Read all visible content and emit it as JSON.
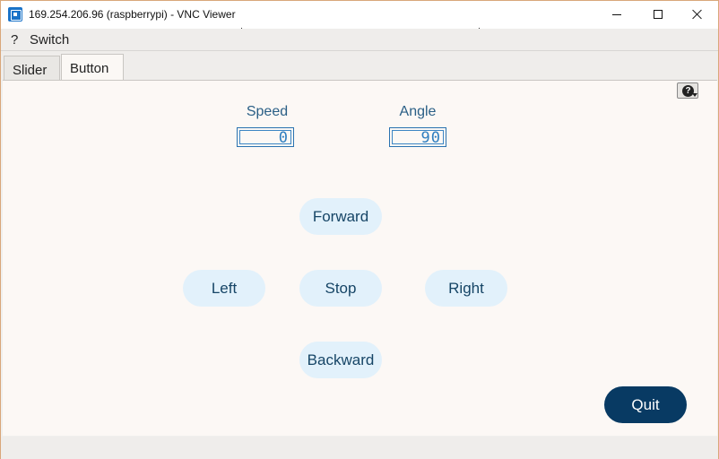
{
  "window": {
    "title": "169.254.206.96 (raspberrypi) - VNC Viewer"
  },
  "menu": {
    "help": "?",
    "switch": "Switch"
  },
  "tabs": [
    {
      "label": "Slider"
    },
    {
      "label": "Button"
    }
  ],
  "help_button": {
    "glyph": "?"
  },
  "gauges": {
    "speed": {
      "label": "Speed",
      "value": "0"
    },
    "angle": {
      "label": "Angle",
      "value": "90"
    }
  },
  "controls": {
    "forward": "Forward",
    "left": "Left",
    "stop": "Stop",
    "right": "Right",
    "backward": "Backward",
    "quit": "Quit"
  },
  "colors": {
    "lcd": "#2f7fc0",
    "pill_bg": "#e2f1fb",
    "pill_text": "#164566",
    "quit_bg": "#083a63"
  }
}
